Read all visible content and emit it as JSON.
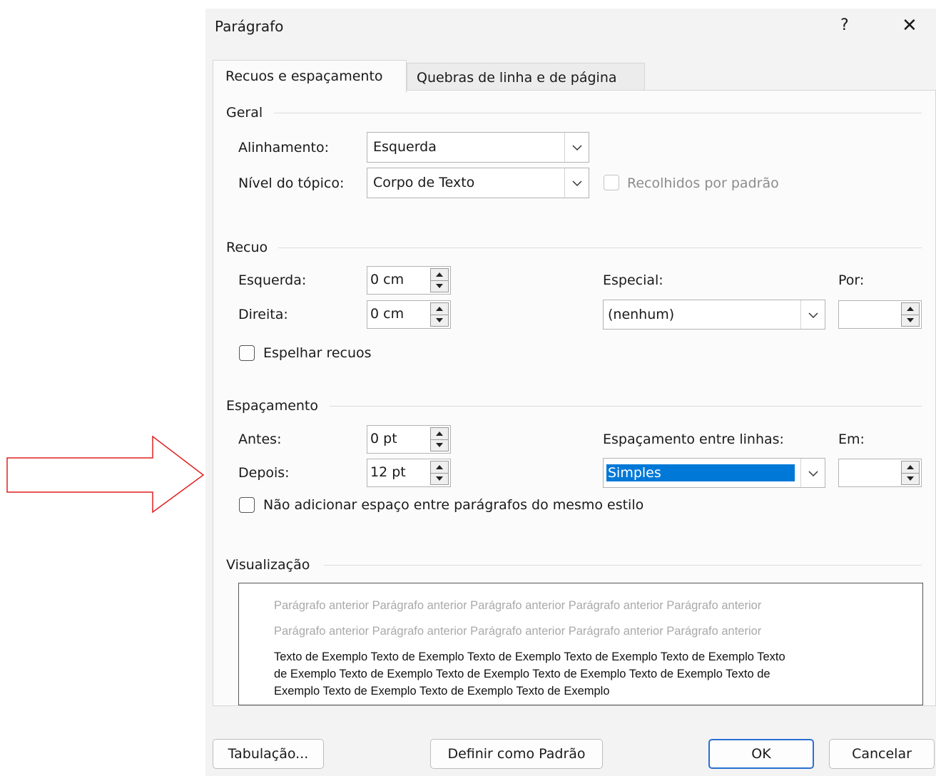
{
  "dialog": {
    "title": "Parágrafo",
    "help_label": "?",
    "close_label": "✕"
  },
  "tabs": [
    {
      "label": "Recuos e espaçamento",
      "active": true
    },
    {
      "label": "Quebras de linha e de página",
      "active": false
    }
  ],
  "geral": {
    "header": "Geral",
    "alinhamento_label": "Alinhamento:",
    "alinhamento_value": "Esquerda",
    "nivel_label": "Nível do tópico:",
    "nivel_value": "Corpo de Texto",
    "recolhidos_label": "Recolhidos por padrão"
  },
  "recuo": {
    "header": "Recuo",
    "esquerda_label": "Esquerda:",
    "esquerda_value": "0 cm",
    "direita_label": "Direita:",
    "direita_value": "0 cm",
    "especial_label": "Especial:",
    "especial_value": "(nenhum)",
    "por_label": "Por:",
    "por_value": "",
    "espelhar_label": "Espelhar recuos"
  },
  "espacamento": {
    "header": "Espaçamento",
    "antes_label": "Antes:",
    "antes_value": "0 pt",
    "depois_label": "Depois:",
    "depois_value": "12 pt",
    "entre_linhas_label": "Espaçamento entre linhas:",
    "entre_linhas_value": "Simples",
    "em_label": "Em:",
    "em_value": "",
    "nao_adicionar_label": "Não adicionar espaço entre parágrafos do mesmo estilo"
  },
  "visualizacao": {
    "header": "Visualização",
    "previous_line_1": "Parágrafo anterior Parágrafo anterior Parágrafo anterior Parágrafo anterior Parágrafo anterior",
    "previous_line_2": "Parágrafo anterior Parágrafo anterior Parágrafo anterior Parágrafo anterior Parágrafo anterior",
    "sample_line_1": "Texto de Exemplo Texto de Exemplo Texto de Exemplo Texto de Exemplo Texto de Exemplo Texto",
    "sample_line_2": "de Exemplo Texto de Exemplo Texto de Exemplo Texto de Exemplo Texto de Exemplo Texto de",
    "sample_line_3": "Exemplo Texto de Exemplo Texto de Exemplo Texto de Exemplo"
  },
  "buttons": {
    "tabulacao": "Tabulação...",
    "definir_padrao": "Definir como Padrão",
    "ok": "OK",
    "cancelar": "Cancelar"
  },
  "colors": {
    "annotation_arrow": "#e02020",
    "selection": "#0078d7",
    "primary_button_border": "#2b6fd1"
  }
}
